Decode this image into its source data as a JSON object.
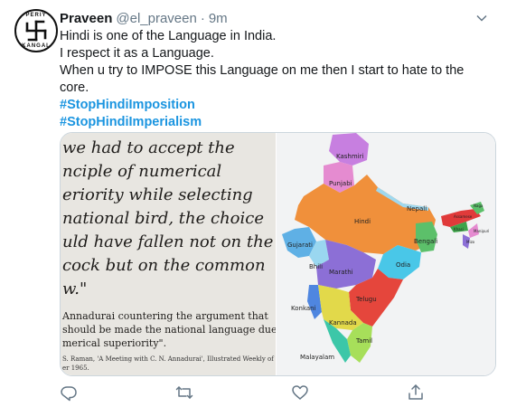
{
  "tweet": {
    "author_name": "Praveen",
    "handle": "@el_praveen",
    "separator": "·",
    "time": "9m",
    "lines": [
      "Hindi is one of the Language in India.",
      "I respect it as a Language.",
      "When u try to IMPOSE this Language on me then I start to hate to the core."
    ],
    "hashtags": [
      "#StopHindiImposition",
      "#StopHindiImperialism"
    ]
  },
  "avatar": {
    "top_text": "PERIY",
    "bottom_text": "KANGAL",
    "icon": "swastika-emblem-icon"
  },
  "book_page": {
    "lines": [
      "we had to accept the",
      "nciple of numerical",
      "eriority while selecting",
      " national bird, the choice",
      "uld have fallen not on the",
      "cock but on the common",
      "w.\""
    ],
    "small_lines": [
      "Annadurai countering the argument that",
      "should be made the national language due to",
      "merical superiority\"."
    ],
    "citation_lines": [
      "S. Raman, 'A Meeting with C. N. Annadurai', Illustrated Weekly of India,",
      "er 1965."
    ]
  },
  "map": {
    "labels": [
      "Kashmiri",
      "Punjabi",
      "Nepali",
      "Hindi",
      "Gujarati",
      "Bengali",
      "Bhili",
      "Marathi",
      "Odia",
      "Konkani",
      "Telugu",
      "Kannada",
      "Tamil",
      "Malayalam",
      "Assamese",
      "Khasi",
      "Manipuri",
      "Mizo",
      "Naga"
    ],
    "colors": {
      "kashmiri": "#c77fe0",
      "punjabi": "#e58bd0",
      "hindi": "#f0903b",
      "gujarati": "#5fb0e5",
      "marathi": "#8c6fd6",
      "bengali": "#5cc06a",
      "odia": "#49c7e8",
      "telugu": "#e5463c",
      "kannada": "#e2d94a",
      "tamil": "#a7df5a",
      "malayalam": "#3cc7a8",
      "konkani": "#4f86e0",
      "bhili": "#9ad7f0",
      "northeast_red": "#e03a3a",
      "northeast_green": "#3ea44a"
    }
  },
  "actions": {
    "icons": [
      "reply-icon",
      "retweet-icon",
      "like-icon",
      "share-icon"
    ]
  }
}
